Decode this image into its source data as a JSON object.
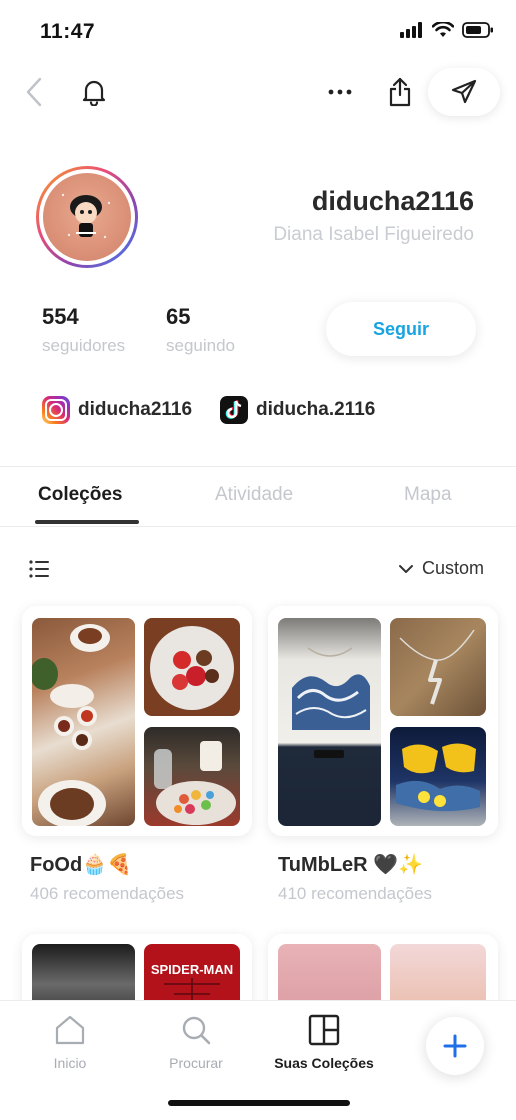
{
  "status": {
    "time": "11:47"
  },
  "profile": {
    "username": "diducha2116",
    "full_name": "Diana Isabel Figueiredo",
    "followers_count": "554",
    "followers_label": "seguidores",
    "following_count": "65",
    "following_label": "seguindo",
    "follow_label": "Seguir",
    "instagram": "diducha2116",
    "tiktok": "diducha.2116"
  },
  "tabs": [
    {
      "label": "Coleções",
      "active": true
    },
    {
      "label": "Atividade",
      "active": false
    },
    {
      "label": "Mapa",
      "active": false
    }
  ],
  "sort": {
    "label": "Custom"
  },
  "collections": [
    {
      "title": "FoOd🧁🍕",
      "subtitle": "406 recomendações"
    },
    {
      "title": "TuMbLeR 🖤✨",
      "subtitle": "410 recomendações"
    }
  ],
  "bottom_nav": {
    "home": "Inicio",
    "search": "Procurar",
    "collections": "Suas Coleções"
  },
  "colors": {
    "accent": "#18a4e0",
    "muted": "#c4c7cd",
    "fab_plus": "#1e6fe8"
  }
}
